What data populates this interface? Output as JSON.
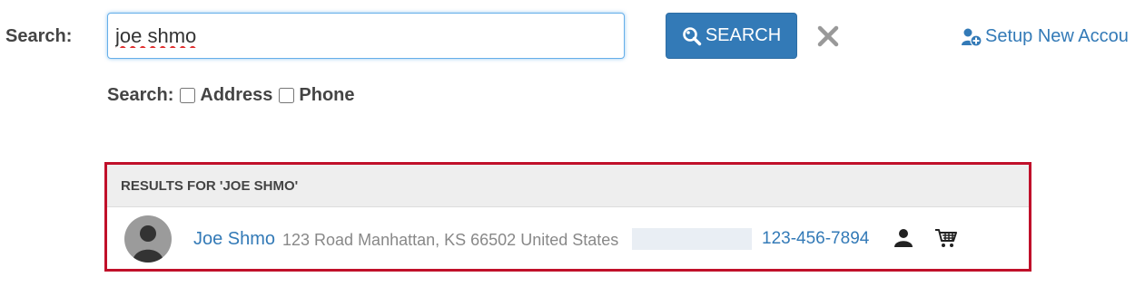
{
  "search": {
    "label": "Search:",
    "value": "joe shmo",
    "button_label": "SEARCH",
    "clear_icon": "close-icon"
  },
  "setup_link": {
    "label": "Setup New Accou",
    "icon": "add-user-icon"
  },
  "options": {
    "label": "Search:",
    "address_label": "Address",
    "phone_label": "Phone",
    "address_checked": false,
    "phone_checked": false
  },
  "results": {
    "header": "RESULTS FOR 'JOE SHMO'",
    "items": [
      {
        "name": "Joe Shmo",
        "address": "123 Road Manhattan, KS 66502 United States",
        "phone": "123-456-7894",
        "avatar_icon": "avatar-placeholder-icon",
        "actions": [
          "profile-icon",
          "cart-icon"
        ]
      }
    ]
  },
  "colors": {
    "primary": "#337ab7",
    "highlight_border": "#c0102a",
    "header_bg": "#eeeeee",
    "muted_text": "#888888"
  }
}
